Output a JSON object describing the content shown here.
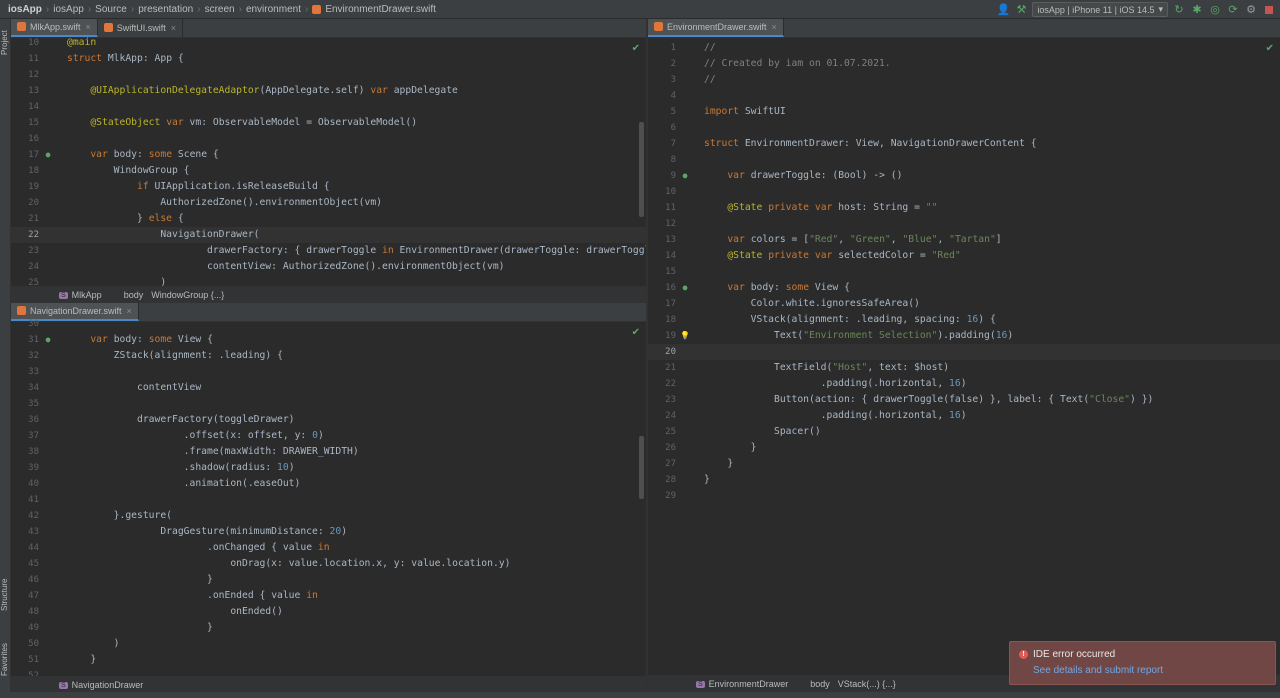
{
  "navbar": {
    "crumbs": [
      "iosApp",
      "iosApp",
      "Source",
      "presentation",
      "screen",
      "environment",
      "EnvironmentDrawer.swift"
    ],
    "run_config": "iosApp | iPhone 11 | iOS 14.5"
  },
  "sidebar": {
    "project": "Project",
    "structure": "Structure",
    "favorites": "Favorites"
  },
  "top_left_pane": {
    "tabs": [
      {
        "label": "MlkApp.swift",
        "active": true
      },
      {
        "label": "SwiftUI.swift",
        "active": false
      }
    ],
    "breadcrumb": [
      "MlkApp",
      "body",
      "WindowGroup {...}"
    ],
    "lines": [
      {
        "n": "10",
        "code": "@main"
      },
      {
        "n": "11",
        "code": "struct MlkApp: App {"
      },
      {
        "n": "12",
        "code": ""
      },
      {
        "n": "13",
        "code": "    @UIApplicationDelegateAdaptor(AppDelegate.self) var appDelegate"
      },
      {
        "n": "14",
        "code": ""
      },
      {
        "n": "15",
        "code": "    @StateObject var vm: ObservableModel = ObservableModel()"
      },
      {
        "n": "16",
        "code": ""
      },
      {
        "n": "17",
        "code": "    var body: some Scene {"
      },
      {
        "n": "18",
        "code": "        WindowGroup {"
      },
      {
        "n": "19",
        "code": "            if UIApplication.isReleaseBuild {"
      },
      {
        "n": "20",
        "code": "                AuthorizedZone().environmentObject(vm)"
      },
      {
        "n": "21",
        "code": "            } else {"
      },
      {
        "n": "22",
        "code": "                NavigationDrawer("
      },
      {
        "n": "23",
        "code": "                        drawerFactory: { drawerToggle in EnvironmentDrawer(drawerToggle: drawerToggle) },"
      },
      {
        "n": "24",
        "code": "                        contentView: AuthorizedZone().environmentObject(vm)"
      },
      {
        "n": "25",
        "code": "                )"
      }
    ]
  },
  "bottom_left_pane": {
    "tabs": [
      {
        "label": "NavigationDrawer.swift",
        "active": true
      }
    ],
    "breadcrumb": [
      "NavigationDrawer"
    ],
    "lines": [
      {
        "n": "30",
        "code": ""
      },
      {
        "n": "31",
        "code": "    var body: some View {"
      },
      {
        "n": "32",
        "code": "        ZStack(alignment: .leading) {"
      },
      {
        "n": "33",
        "code": ""
      },
      {
        "n": "34",
        "code": "            contentView"
      },
      {
        "n": "35",
        "code": ""
      },
      {
        "n": "36",
        "code": "            drawerFactory(toggleDrawer)"
      },
      {
        "n": "37",
        "code": "                    .offset(x: offset, y: 0)"
      },
      {
        "n": "38",
        "code": "                    .frame(maxWidth: DRAWER_WIDTH)"
      },
      {
        "n": "39",
        "code": "                    .shadow(radius: 10)"
      },
      {
        "n": "40",
        "code": "                    .animation(.easeOut)"
      },
      {
        "n": "41",
        "code": ""
      },
      {
        "n": "42",
        "code": "        }.gesture("
      },
      {
        "n": "43",
        "code": "                DragGesture(minimumDistance: 20)"
      },
      {
        "n": "44",
        "code": "                        .onChanged { value in"
      },
      {
        "n": "45",
        "code": "                            onDrag(x: value.location.x, y: value.location.y)"
      },
      {
        "n": "46",
        "code": "                        }"
      },
      {
        "n": "47",
        "code": "                        .onEnded { value in"
      },
      {
        "n": "48",
        "code": "                            onEnded()"
      },
      {
        "n": "49",
        "code": "                        }"
      },
      {
        "n": "50",
        "code": "        )"
      },
      {
        "n": "51",
        "code": "    }"
      },
      {
        "n": "52",
        "code": ""
      }
    ]
  },
  "right_pane": {
    "tabs": [
      {
        "label": "EnvironmentDrawer.swift",
        "active": true
      }
    ],
    "breadcrumb": [
      "EnvironmentDrawer",
      "body",
      "VStack(...) {...}"
    ],
    "lines": [
      {
        "n": "1",
        "code": "//"
      },
      {
        "n": "2",
        "code": "// Created by iam on 01.07.2021."
      },
      {
        "n": "3",
        "code": "//"
      },
      {
        "n": "4",
        "code": ""
      },
      {
        "n": "5",
        "code": "import SwiftUI"
      },
      {
        "n": "6",
        "code": ""
      },
      {
        "n": "7",
        "code": "struct EnvironmentDrawer: View, NavigationDrawerContent {"
      },
      {
        "n": "8",
        "code": ""
      },
      {
        "n": "9",
        "code": "    var drawerToggle: (Bool) -> ()"
      },
      {
        "n": "10",
        "code": ""
      },
      {
        "n": "11",
        "code": "    @State private var host: String = \"\""
      },
      {
        "n": "12",
        "code": ""
      },
      {
        "n": "13",
        "code": "    var colors = [\"Red\", \"Green\", \"Blue\", \"Tartan\"]"
      },
      {
        "n": "14",
        "code": "    @State private var selectedColor = \"Red\""
      },
      {
        "n": "15",
        "code": ""
      },
      {
        "n": "16",
        "code": "    var body: some View {"
      },
      {
        "n": "17",
        "code": "        Color.white.ignoresSafeArea()"
      },
      {
        "n": "18",
        "code": "        VStack(alignment: .leading, spacing: 16) {"
      },
      {
        "n": "19",
        "code": "            Text(\"Environment Selection\").padding(16)"
      },
      {
        "n": "20",
        "code": ""
      },
      {
        "n": "21",
        "code": "            TextField(\"Host\", text: $host)"
      },
      {
        "n": "22",
        "code": "                    .padding(.horizontal, 16)"
      },
      {
        "n": "23",
        "code": "            Button(action: { drawerToggle(false) }, label: { Text(\"Close\") })"
      },
      {
        "n": "24",
        "code": "                    .padding(.horizontal, 16)"
      },
      {
        "n": "25",
        "code": "            Spacer()"
      },
      {
        "n": "26",
        "code": "        }"
      },
      {
        "n": "27",
        "code": "    }"
      },
      {
        "n": "28",
        "code": "}"
      },
      {
        "n": "29",
        "code": ""
      }
    ]
  },
  "toast": {
    "title": "IDE error occurred",
    "link": "See details and submit report"
  }
}
